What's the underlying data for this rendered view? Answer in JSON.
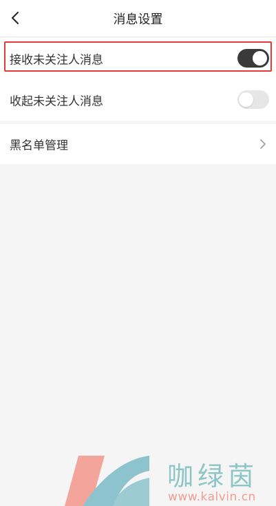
{
  "header": {
    "title": "消息设置",
    "back_icon": "chevron-left-icon"
  },
  "settings": {
    "receive_unfollowed": {
      "label": "接收未关注人消息",
      "enabled": true
    },
    "fold_unfollowed": {
      "label": "收起未关注人消息",
      "enabled": false
    },
    "blacklist": {
      "label": "黑名单管理",
      "icon": "chevron-right-icon"
    }
  },
  "watermark": {
    "text": "咖绿茵",
    "url": "www.kalvin.cn"
  },
  "colors": {
    "highlight": "#e53935",
    "toggle_on": "#3a3a3a",
    "toggle_off": "#e6e6e6",
    "watermark_teal": "#8ec5c5",
    "watermark_salmon": "#f19c92"
  }
}
